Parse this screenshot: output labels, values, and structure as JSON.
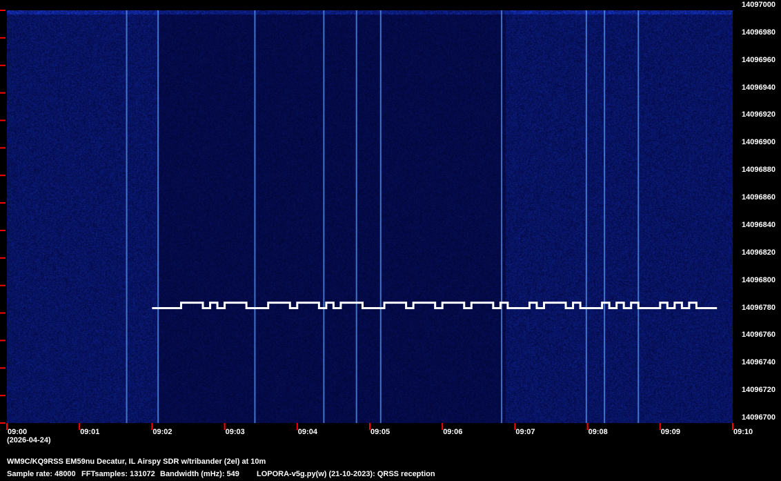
{
  "chart_data": {
    "type": "heatmap",
    "title": "QRSS spectrogram",
    "x_axis": {
      "unit": "time",
      "start": "09:00",
      "end": "09:10",
      "date": "(2026-04-24)",
      "tick_labels": [
        "09:00",
        "09:01",
        "09:02",
        "09:03",
        "09:04",
        "09:05",
        "09:06",
        "09:07",
        "09:08",
        "09:09",
        "09:10"
      ]
    },
    "y_axis": {
      "unit": "Hz",
      "range": [
        14096700,
        14097000
      ],
      "tick_labels": [
        "14097000",
        "14096980",
        "14096960",
        "14096940",
        "14096920",
        "14096900",
        "14096880",
        "14096860",
        "14096840",
        "14096820",
        "14096800",
        "14096780",
        "14096760",
        "14096740",
        "14096720",
        "14096700"
      ]
    },
    "fsk_trace": {
      "low_hz": 14096783.5,
      "high_hz": 14096787.5,
      "start_level": 0,
      "switch_times_s": [
        120,
        144,
        162,
        168,
        174,
        180,
        198,
        216,
        234,
        240,
        258,
        264,
        270,
        276,
        294,
        312,
        330,
        336,
        354,
        360,
        378,
        384,
        402,
        408,
        414,
        432,
        438,
        444,
        462,
        468,
        474,
        492,
        498,
        504,
        510,
        516,
        522,
        540,
        546,
        552,
        558,
        564,
        570,
        587
      ]
    },
    "broadband_events_s": [
      99,
      125,
      205,
      262,
      289,
      309,
      409,
      479,
      494,
      522
    ],
    "colors": {
      "background": "#020a28",
      "signal": "#ffffff",
      "tick": "#ff0000"
    }
  },
  "footer": {
    "line1": "WM9C/KQ9RSS EM59nu Decatur, IL  Airspy SDR w/tribander (2el) at 10m",
    "sample_rate": "Sample rate: 48000",
    "fft": "FFTsamples: 131072",
    "bandwidth": "Bandwidth (mHz): 549",
    "software": "LOPORA-v5g.py(w) (21-10-2023): QRSS reception"
  }
}
